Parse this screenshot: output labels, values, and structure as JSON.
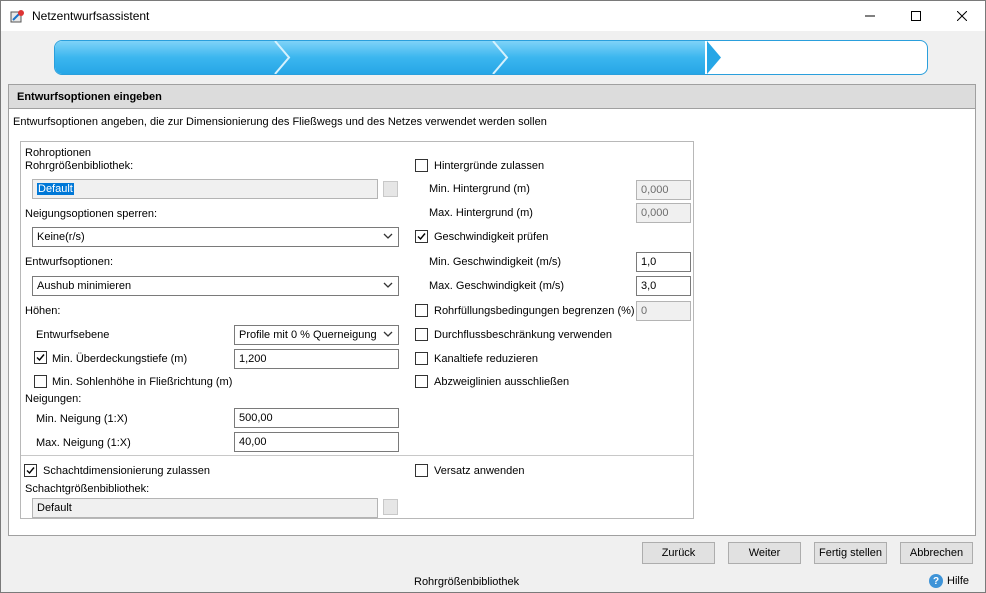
{
  "window": {
    "title": "Netzentwurfsassistent"
  },
  "progress": {
    "steps_total": 4,
    "steps_done": 3
  },
  "panel": {
    "title": "Entwurfsoptionen eingeben",
    "description": "Entwurfsoptionen angeben, die zur Dimensionierung des Fließwegs und des Netzes verwendet werden sollen"
  },
  "group": {
    "title": "Rohroptionen"
  },
  "left": {
    "pipe_library_label": "Rohrgrößenbibliothek:",
    "pipe_library_value": "Default",
    "slope_lock_label": "Neigungsoptionen sperren:",
    "slope_lock_value": "Keine(r/s)",
    "design_options_label": "Entwurfsoptionen:",
    "design_options_value": "Aushub minimieren",
    "heights_label": "Höhen:",
    "design_plane_label": "Entwurfsebene",
    "design_plane_value": "Profile mit 0 % Querneigung",
    "min_cover_label": "Min. Überdeckungstiefe (m)",
    "min_cover_checked": true,
    "min_cover_value": "1,200",
    "min_invert_label": "Min. Sohlenhöhe in Fließrichtung (m)",
    "min_invert_checked": false,
    "slopes_label": "Neigungen:",
    "min_slope_label": "Min. Neigung (1:X)",
    "min_slope_value": "500,00",
    "max_slope_label": "Max. Neigung (1:X)",
    "max_slope_value": "40,00"
  },
  "right": {
    "backgrounds_label": "Hintergründe zulassen",
    "backgrounds_checked": false,
    "min_bg_label": "Min. Hintergrund (m)",
    "min_bg_value": "0,000",
    "max_bg_label": "Max. Hintergrund (m)",
    "max_bg_value": "0,000",
    "velocity_label": "Geschwindigkeit prüfen",
    "velocity_checked": true,
    "min_vel_label": "Min. Geschwindigkeit (m/s)",
    "min_vel_value": "1,0",
    "max_vel_label": "Max. Geschwindigkeit (m/s)",
    "max_vel_value": "3,0",
    "fill_label": "Rohrfüllungsbedingungen begrenzen (%)",
    "fill_checked": false,
    "fill_value": "0",
    "flow_label": "Durchflussbeschränkung verwenden",
    "flow_checked": false,
    "channel_label": "Kanaltiefe reduzieren",
    "channel_checked": false,
    "branch_label": "Abzweiglinien ausschließen",
    "branch_checked": false
  },
  "bottom": {
    "manhole_label": "Schachtdimensionierung zulassen",
    "manhole_checked": true,
    "manhole_lib_label": "Schachtgrößenbibliothek:",
    "manhole_lib_value": "Default",
    "offset_label": "Versatz anwenden",
    "offset_checked": false
  },
  "buttons": {
    "back": "Zurück",
    "next": "Weiter",
    "finish": "Fertig stellen",
    "cancel": "Abbrechen"
  },
  "status": {
    "text": "Rohrgrößenbibliothek"
  },
  "help": {
    "label": "Hilfe"
  },
  "colors": {
    "accent": "#26a6e6",
    "selection": "#0078d7"
  }
}
